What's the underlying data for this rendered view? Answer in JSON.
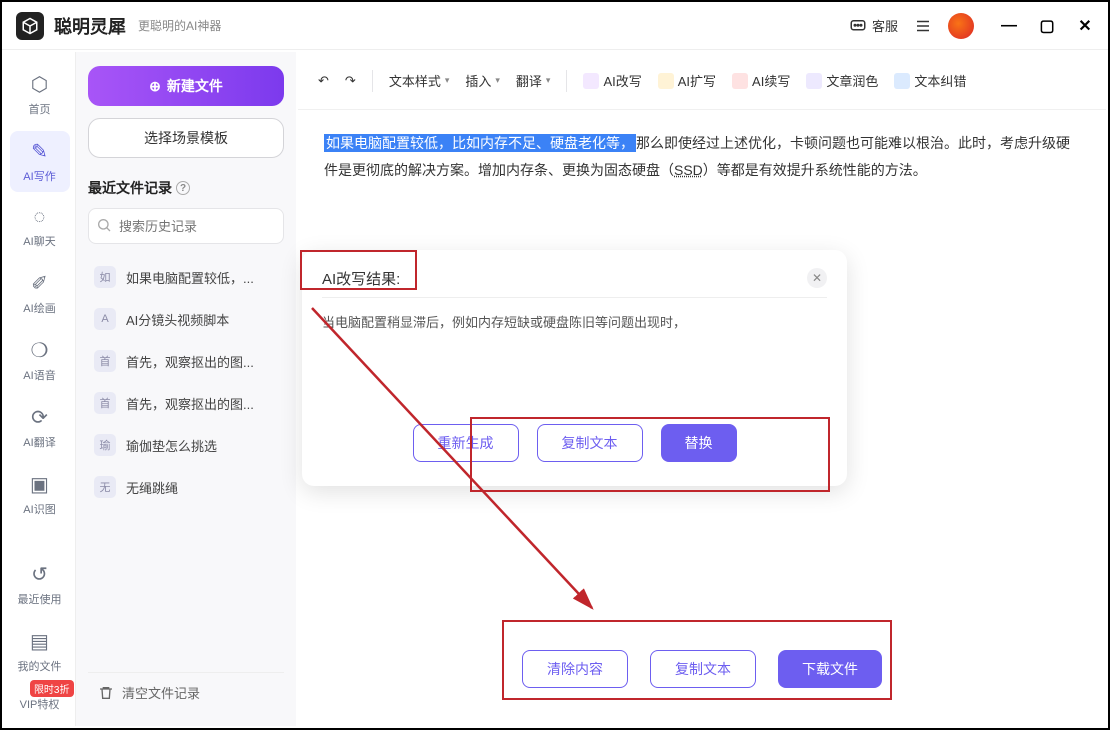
{
  "app": {
    "title": "聪明灵犀",
    "subtitle": "更聪明的AI神器"
  },
  "titlebar": {
    "support": "客服",
    "minimize": "—",
    "maximize": "▢",
    "close": "✕"
  },
  "rail": {
    "items": [
      {
        "label": "首页",
        "glyph": "⬡"
      },
      {
        "label": "AI写作",
        "glyph": "✎"
      },
      {
        "label": "AI聊天",
        "glyph": "◌"
      },
      {
        "label": "AI绘画",
        "glyph": "✐"
      },
      {
        "label": "AI语音",
        "glyph": "❍"
      },
      {
        "label": "AI翻译",
        "glyph": "⟳"
      },
      {
        "label": "AI识图",
        "glyph": "▣"
      }
    ],
    "recent": "最近使用",
    "myfiles": "我的文件",
    "vip_label": "VIP特权",
    "vip_badge": "限时3折"
  },
  "panel": {
    "new_file": "新建文件",
    "choose_tpl": "选择场景模板",
    "recent_header": "最近文件记录",
    "search_placeholder": "搜索历史记录",
    "history": [
      {
        "chip": "如",
        "label": "如果电脑配置较低，..."
      },
      {
        "chip": "A",
        "label": "AI分镜头视频脚本"
      },
      {
        "chip": "首",
        "label": "首先，观察抠出的图..."
      },
      {
        "chip": "首",
        "label": "首先，观察抠出的图..."
      },
      {
        "chip": "瑜",
        "label": "瑜伽垫怎么挑选"
      },
      {
        "chip": "无",
        "label": "无绳跳绳"
      }
    ],
    "clear": "清空文件记录"
  },
  "toolbar": {
    "undo": "↶",
    "redo": "↷",
    "text_style": "文本样式",
    "insert": "插入",
    "translate": "翻译",
    "rewrite": "AI改写",
    "expand": "AI扩写",
    "continue": "AI续写",
    "polish": "文章润色",
    "correct": "文本纠错"
  },
  "editor": {
    "highlighted": "如果电脑配置较低，比如内存不足、硬盘老化等，",
    "body_a": "那么即使经过上述优化，卡顿问题也可能难以根治。此时，考虑升级硬件是更彻底的解决方案。增加内存条、更换为固态硬盘（",
    "ssd": "SSD",
    "body_b": "）等都是有效提升系统性能的方法。"
  },
  "popup": {
    "title": "AI改写结果:",
    "body": "当电脑配置稍显滞后，例如内存短缺或硬盘陈旧等问题出现时，",
    "regen": "重新生成",
    "copy": "复制文本",
    "replace": "替换"
  },
  "footer": {
    "clear": "清除内容",
    "copy": "复制文本",
    "download": "下载文件"
  }
}
